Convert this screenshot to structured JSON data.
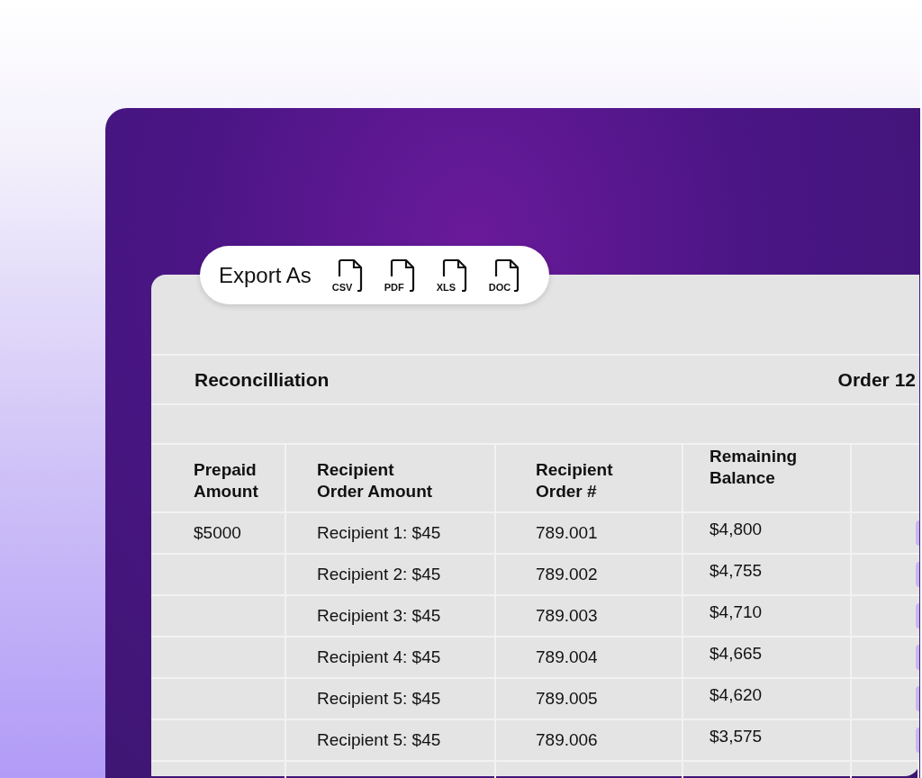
{
  "export": {
    "label": "Export As",
    "formats": [
      "CSV",
      "PDF",
      "XLS",
      "DOC"
    ]
  },
  "report": {
    "title": "Reconcilliation",
    "order": "Order 12"
  },
  "table": {
    "columns": [
      "Prepaid\nAmount",
      "Recipient\nOrder Amount",
      "Recipient\nOrder #",
      "Remaining\nBalance"
    ],
    "rows": [
      [
        "$5000",
        "Recipient 1: $45",
        "789.001",
        "$4,800"
      ],
      [
        "",
        "Recipient 2: $45",
        "789.002",
        "$4,755"
      ],
      [
        "",
        "Recipient 3: $45",
        "789.003",
        "$4,710"
      ],
      [
        "",
        "Recipient 4: $45",
        "789.004",
        "$4,665"
      ],
      [
        "",
        "Recipient 5: $45",
        "789.005",
        "$4,620"
      ],
      [
        "",
        "Recipient 5: $45",
        "789.006",
        "$3,575"
      ]
    ]
  }
}
